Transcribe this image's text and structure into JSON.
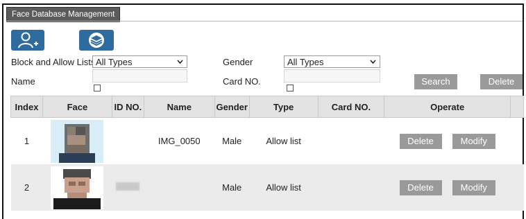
{
  "tab": {
    "title": "Face Database Management"
  },
  "toolbar": {
    "add_icon": "add-user-icon",
    "layers_icon": "layers-icon"
  },
  "filters": {
    "list_label": "Block and Allow Lists",
    "list_value": "All Types",
    "gender_label": "Gender",
    "gender_value": "All Types",
    "name_label": "Name",
    "name_value": "",
    "card_label": "Card NO.",
    "card_value": "",
    "search_label": "Search",
    "delete_label": "Delete"
  },
  "table": {
    "columns": [
      "Index",
      "Face",
      "ID NO.",
      "Name",
      "Gender",
      "Type",
      "Card NO.",
      "Operate"
    ],
    "rows": [
      {
        "index": "1",
        "id_no": "",
        "name": "IMG_0050",
        "gender": "Male",
        "type": "Allow list",
        "card_no": "",
        "delete": "Delete",
        "modify": "Modify"
      },
      {
        "index": "2",
        "id_no": "",
        "name": "",
        "gender": "Male",
        "type": "Allow list",
        "card_no": "",
        "delete": "Delete",
        "modify": "Modify"
      }
    ]
  },
  "colors": {
    "accent": "#2e6b9e",
    "tab_bg": "#5b5b5b",
    "button_gray": "#9a9a9a",
    "header_bg": "#e3e3e3"
  }
}
